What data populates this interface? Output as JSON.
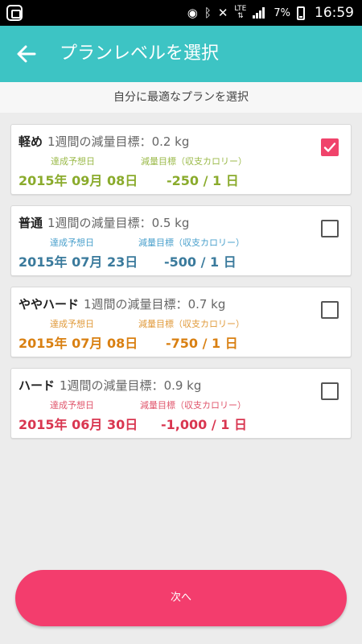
{
  "status_bar": {
    "battery": "7%",
    "time": "16:59",
    "network": "LTE"
  },
  "header": {
    "title": "プランレベルを選択"
  },
  "subheader": "自分に最適なプランを選択",
  "plans": [
    {
      "name": "軽め",
      "goal_label": "1週間の減量目標：",
      "goal_value": "0.2 kg",
      "date_label": "達成予想日",
      "calorie_label": "減量目標（収支カロリー）",
      "date": "2015年 09月 08日",
      "calories": "-250 / 1 日",
      "checked": true,
      "accent_color": "#8aab2c",
      "label_color": "#9bba4a"
    },
    {
      "name": "普通",
      "goal_label": "1週間の減量目標：",
      "goal_value": "0.5 kg",
      "date_label": "達成予想日",
      "calorie_label": "減量目標（収支カロリー）",
      "date": "2015年 07月 23日",
      "calories": "-500 / 1 日",
      "checked": false,
      "accent_color": "#3a7a9c",
      "label_color": "#4aa0cc"
    },
    {
      "name": "ややハード",
      "goal_label": "1週間の減量目標：",
      "goal_value": "0.7 kg",
      "date_label": "達成予想日",
      "calorie_label": "減量目標（収支カロリー）",
      "date": "2015年 07月 08日",
      "calories": "-750 / 1 日",
      "checked": false,
      "accent_color": "#d98012",
      "label_color": "#e09a3a"
    },
    {
      "name": "ハード",
      "goal_label": "1週間の減量目標：",
      "goal_value": "0.9 kg",
      "date_label": "達成予想日",
      "calorie_label": "減量目標（収支カロリー）",
      "date": "2015年 06月 30日",
      "calories": "-1,000 / 1 日",
      "checked": false,
      "accent_color": "#d93650",
      "label_color": "#e0566c"
    }
  ],
  "next_button": "次へ"
}
